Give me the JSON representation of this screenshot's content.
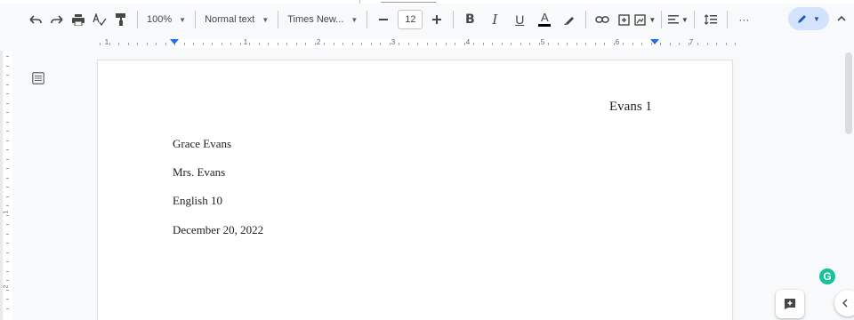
{
  "toolbar": {
    "zoom": "100%",
    "style": "Normal text",
    "font": "Times New...",
    "font_size": "12",
    "bold": "B",
    "italic": "I",
    "underline": "U",
    "text_color": "A",
    "more": "···"
  },
  "ruler": {
    "numbers": [
      "1",
      "1",
      "2",
      "3",
      "4",
      "5",
      "6",
      "7"
    ]
  },
  "vertical_ruler": {
    "numbers": [
      "1",
      "2"
    ]
  },
  "document": {
    "header": "Evans 1",
    "lines": [
      "Grace Evans",
      "Mrs. Evans",
      "English 10",
      "December 20, 2022"
    ]
  },
  "colors": {
    "accent": "#1a73e8",
    "editing_pill": "#d3e3fd",
    "grammarly": "#15c39a"
  },
  "icons": [
    "undo-icon",
    "redo-icon",
    "print-icon",
    "spellcheck-icon",
    "paint-format-icon",
    "highlighter-icon",
    "link-icon",
    "add-comment-icon",
    "insert-image-icon",
    "align-icon",
    "line-spacing-icon",
    "edit-pencil-icon",
    "chevron-up-icon",
    "outline-icon",
    "grammarly-icon",
    "chevron-left-icon"
  ],
  "grammarly": {
    "label": "G"
  }
}
